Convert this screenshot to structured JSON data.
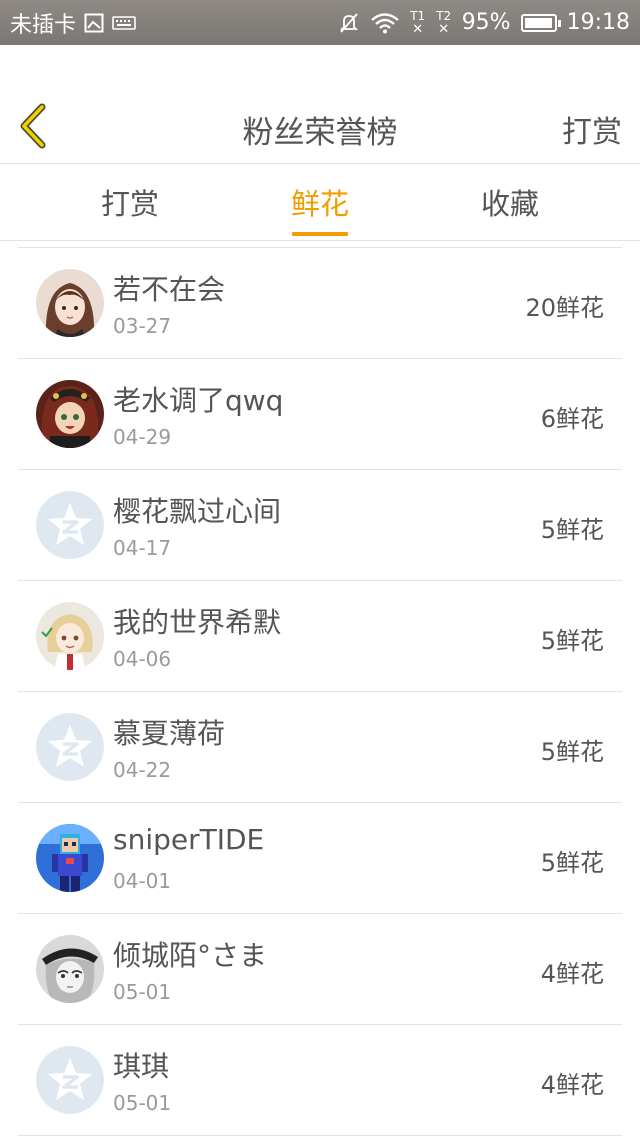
{
  "status_bar": {
    "carrier": "未插卡",
    "sim1_label": "T1",
    "sim2_label": "T2",
    "battery_pct": "95%",
    "battery_level": 0.95,
    "time": "19:18"
  },
  "header": {
    "title": "粉丝荣誉榜",
    "right_action": "打赏"
  },
  "tabs": [
    {
      "label": "打赏",
      "active": false
    },
    {
      "label": "鲜花",
      "active": true
    },
    {
      "label": "收藏",
      "active": false
    }
  ],
  "colors": {
    "accent": "#f39c00",
    "status_bar": "#85807c"
  },
  "fans": [
    {
      "name": "若不在会",
      "date": "03-27",
      "count": "20鲜花",
      "avatar": "anime-girl-avatar"
    },
    {
      "name": "老水调了qwq",
      "date": "04-29",
      "count": "6鲜花",
      "avatar": "anime-red-avatar"
    },
    {
      "name": "樱花飘过心间",
      "date": "04-17",
      "count": "5鲜花",
      "avatar": "default-star-avatar"
    },
    {
      "name": "我的世界希默",
      "date": "04-06",
      "count": "5鲜花",
      "avatar": "anime-cute-avatar"
    },
    {
      "name": "慕夏薄荷",
      "date": "04-22",
      "count": "5鲜花",
      "avatar": "default-star-avatar"
    },
    {
      "name": "sniperTIDE",
      "date": "04-01",
      "count": "5鲜花",
      "avatar": "pixel-blue-avatar"
    },
    {
      "name": "倾城陌°さま",
      "date": "05-01",
      "count": "4鲜花",
      "avatar": "anime-bw-avatar"
    },
    {
      "name": "琪琪",
      "date": "05-01",
      "count": "4鲜花",
      "avatar": "default-star-avatar"
    }
  ]
}
